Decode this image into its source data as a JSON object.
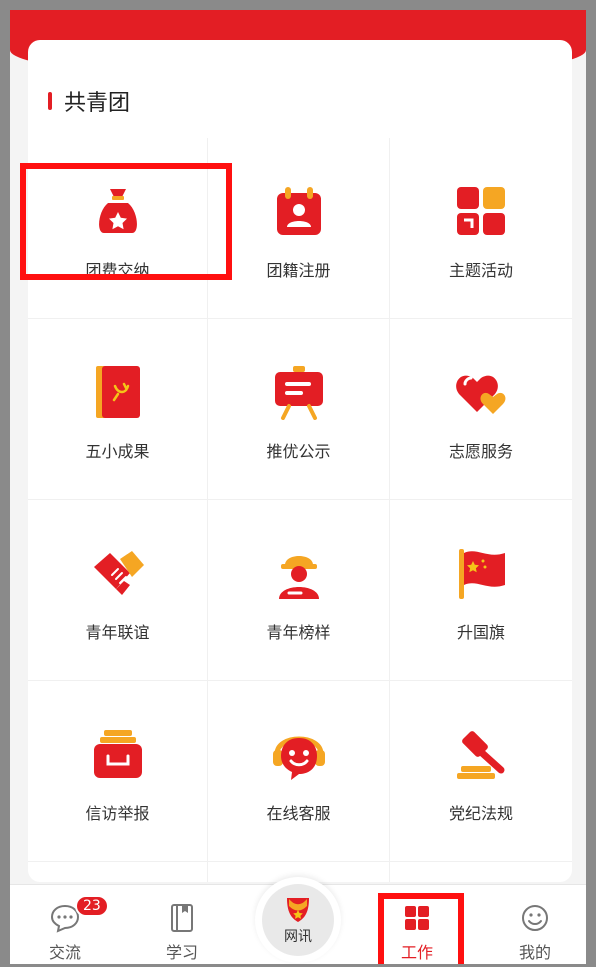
{
  "section": {
    "title": "共青团"
  },
  "colors": {
    "accent": "#e31e24",
    "secondary": "#f5a623"
  },
  "grid": [
    {
      "label": "团费交纳",
      "icon": "money-bag-icon"
    },
    {
      "label": "团籍注册",
      "icon": "calendar-person-icon"
    },
    {
      "label": "主题活动",
      "icon": "theme-blocks-icon"
    },
    {
      "label": "五小成果",
      "icon": "party-book-icon"
    },
    {
      "label": "推优公示",
      "icon": "easel-board-icon"
    },
    {
      "label": "志愿服务",
      "icon": "hearts-icon"
    },
    {
      "label": "青年联谊",
      "icon": "handshake-icon"
    },
    {
      "label": "青年榜样",
      "icon": "worker-helmet-icon"
    },
    {
      "label": "升国旗",
      "icon": "flag-icon"
    },
    {
      "label": "信访举报",
      "icon": "mail-tray-icon"
    },
    {
      "label": "在线客服",
      "icon": "headset-icon"
    },
    {
      "label": "党纪法规",
      "icon": "gavel-icon"
    }
  ],
  "tabbar": {
    "tabs": [
      {
        "label": "交流",
        "badge": "23",
        "icon": "chat-icon"
      },
      {
        "label": "学习",
        "icon": "book-icon"
      },
      {
        "label": "网讯",
        "icon": "league-emblem-icon"
      },
      {
        "label": "工作",
        "icon": "grid-icon",
        "active": true
      },
      {
        "label": "我的",
        "icon": "smile-icon"
      }
    ]
  }
}
